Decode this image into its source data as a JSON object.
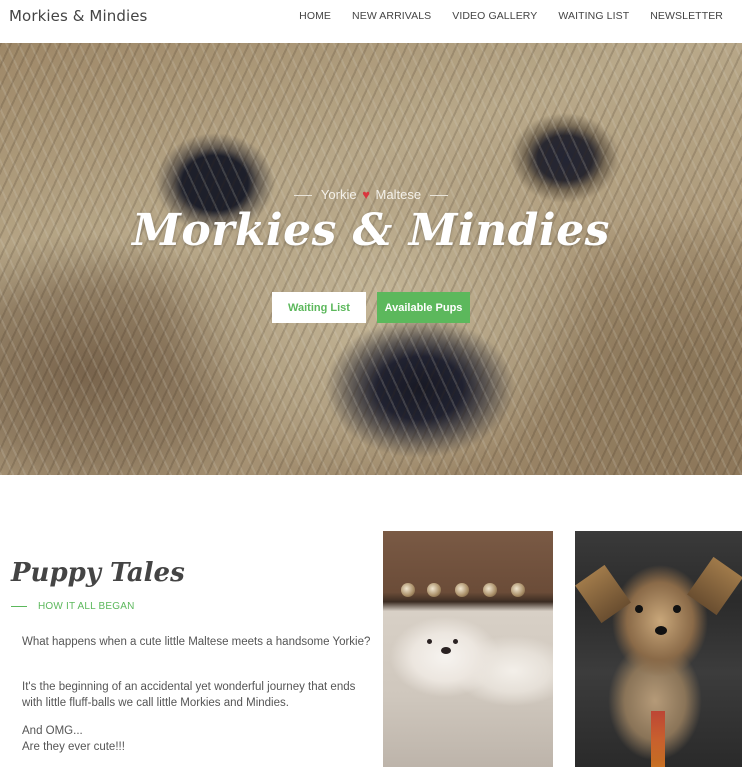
{
  "header": {
    "logo": "Morkies & Mindies",
    "nav": [
      "HOME",
      "NEW ARRIVALS",
      "VIDEO GALLERY",
      "WAITING LIST",
      "NEWSLETTER"
    ]
  },
  "hero": {
    "tagline_left": "Yorkie",
    "tagline_heart": "♥",
    "tagline_right": "Maltese",
    "title": "Morkies & Mindies",
    "buttons": {
      "waiting_list": "Waiting List",
      "available_pups": "Available Pups"
    }
  },
  "tales": {
    "title": "Puppy Tales",
    "subheading": "HOW IT ALL BEGAN",
    "paragraph_1": "What happens when a cute little Maltese meets a handsome Yorkie?",
    "paragraph_2": "It's the beginning of an accidental yet wonderful journey that ends with little fluff-balls we call little Morkies and Mindies.",
    "paragraph_3_line_1": "And OMG...",
    "paragraph_3_line_2": "Are they ever cute!!!"
  },
  "colors": {
    "accent_green": "#5cb85c",
    "heart_red": "#d9363e",
    "text_dark": "#444444"
  }
}
